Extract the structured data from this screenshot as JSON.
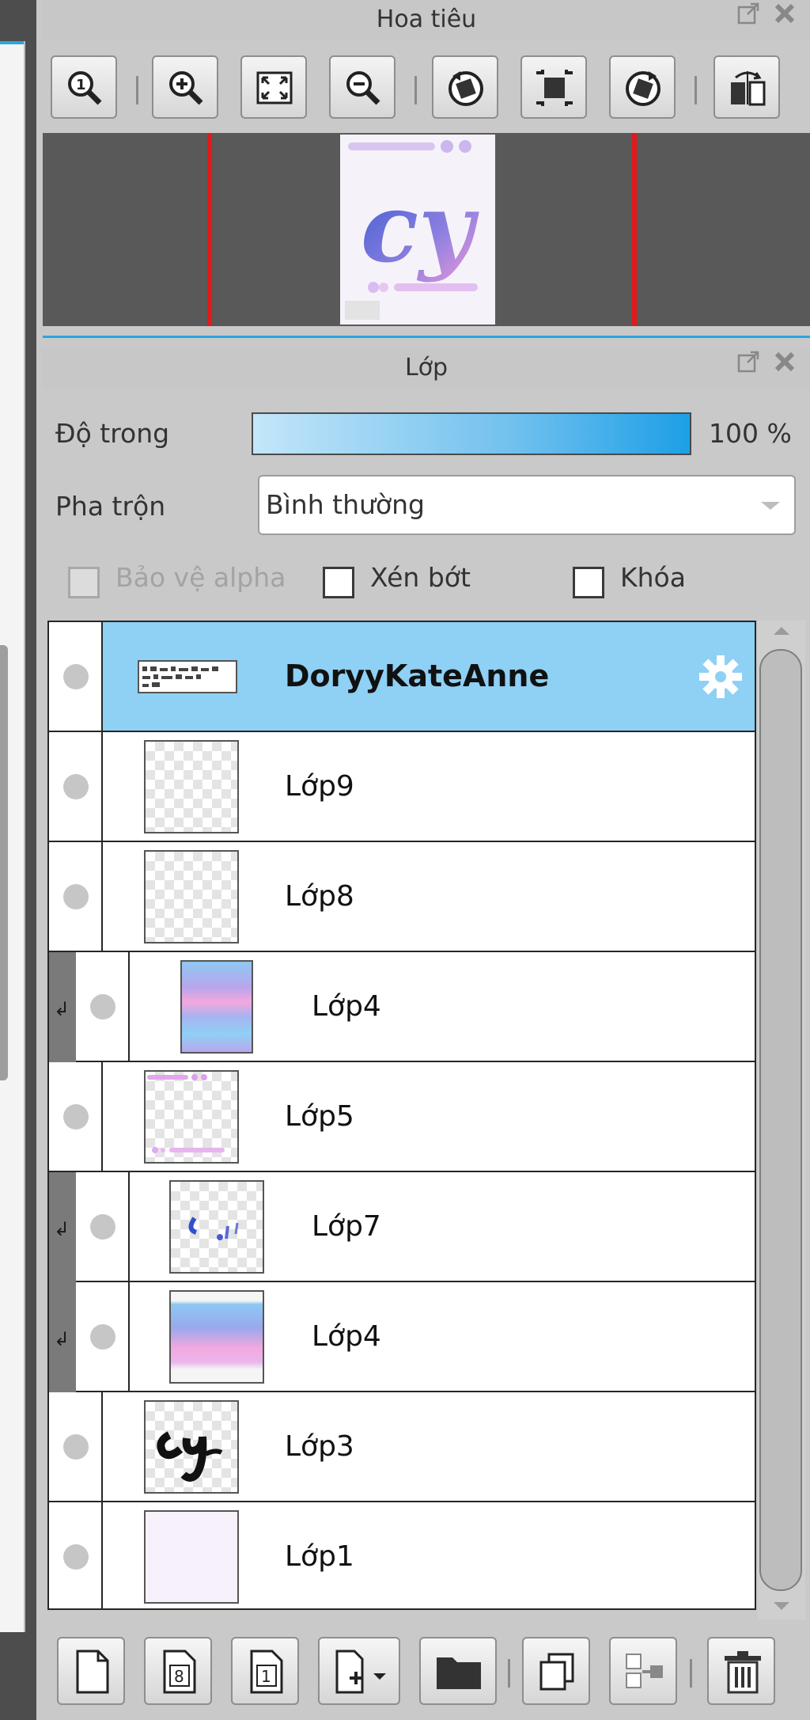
{
  "navigator": {
    "title": "Hoa tiêu",
    "tools": [
      "zoom-actual-size-icon",
      "zoom-in-icon",
      "fit-window-icon",
      "zoom-out-icon",
      "rotate-left-icon",
      "reset-view-icon",
      "rotate-right-icon",
      "flip-horizontal-icon"
    ]
  },
  "layer_panel": {
    "title": "Lớp",
    "opacity_label": "Độ trong",
    "opacity_value": "100 %",
    "opacity": 1.0,
    "blend_label": "Pha trộn",
    "blend_value": "Bình thường",
    "protect_alpha_label": "Bảo vệ alpha",
    "clipping_label": "Xén bớt",
    "lock_label": "Khóa"
  },
  "layers": [
    {
      "name": "DoryyKateAnne",
      "selected": true,
      "clipped": false,
      "settings_icon": "gear-icon",
      "thumb": "text-strip"
    },
    {
      "name": "Lớp9",
      "selected": false,
      "clipped": false,
      "thumb": "empty"
    },
    {
      "name": "Lớp8",
      "selected": false,
      "clipped": false,
      "thumb": "empty"
    },
    {
      "name": "Lớp4",
      "selected": false,
      "clipped": true,
      "thumb": "gradient"
    },
    {
      "name": "Lớp5",
      "selected": false,
      "clipped": false,
      "thumb": "dots"
    },
    {
      "name": "Lớp7",
      "selected": false,
      "clipped": true,
      "thumb": "strokes"
    },
    {
      "name": "Lớp4",
      "selected": false,
      "clipped": true,
      "thumb": "gradient"
    },
    {
      "name": "Lớp3",
      "selected": false,
      "clipped": false,
      "thumb": "lettering"
    },
    {
      "name": "Lớp1",
      "selected": false,
      "clipped": false,
      "thumb": "faint"
    }
  ],
  "bottom_toolbar": [
    "new-layer-icon",
    "new-8bit-layer-icon",
    "new-1bit-layer-icon",
    "add-layer-menu-icon",
    "new-folder-icon",
    "duplicate-layer-icon",
    "merge-down-icon",
    "delete-layer-icon"
  ],
  "colors": {
    "accent": "#2aa6e0",
    "selected_row": "#8fd0f5",
    "navigator_frame": "#e01b1b"
  }
}
